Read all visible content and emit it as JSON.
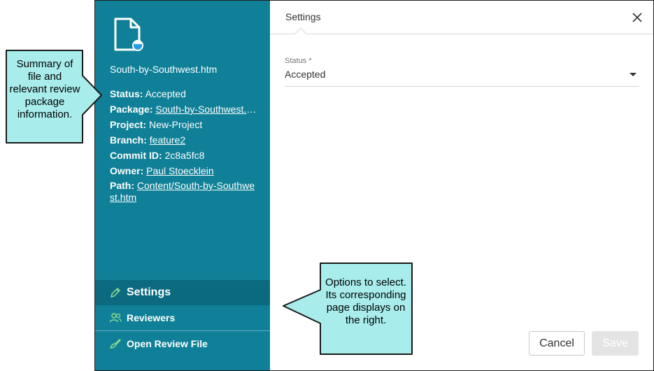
{
  "file": {
    "name": "South-by-Southwest.htm"
  },
  "meta": {
    "status_key": "Status:",
    "status_value": "Accepted",
    "package_key": "Package:",
    "package_value": "South-by-Southwest.h...",
    "project_key": "Project:",
    "project_value": "New-Project",
    "branch_key": "Branch:",
    "branch_value": "feature2",
    "commit_key": "Commit ID:",
    "commit_value": "2c8a5fc8",
    "owner_key": "Owner:",
    "owner_value": "Paul Stoecklein",
    "path_key": "Path:",
    "path_value": "Content/South-by-Southwest.htm"
  },
  "nav": {
    "settings_label": "Settings",
    "reviewers_label": "Reviewers",
    "open_label": "Open Review File"
  },
  "main": {
    "tab_title": "Settings",
    "status_label": "Status *",
    "status_value": "Accepted",
    "cancel_label": "Cancel",
    "save_label": "Save"
  },
  "callouts": {
    "left": "Summary of file and relevant review package information.",
    "bottom": "Options to select. Its corresponding page displays on the right."
  },
  "colors": {
    "sidebar": "#0f8097",
    "sidebar_active": "#0b6a80",
    "nav_icon": "#8fe08f",
    "callout_fill": "#a8ecec"
  },
  "icons": {
    "file": "file-icon",
    "close": "close-icon",
    "settings": "pencil-icon",
    "reviewers": "users-icon",
    "open": "brush-icon",
    "dropdown": "caret-down-icon"
  }
}
